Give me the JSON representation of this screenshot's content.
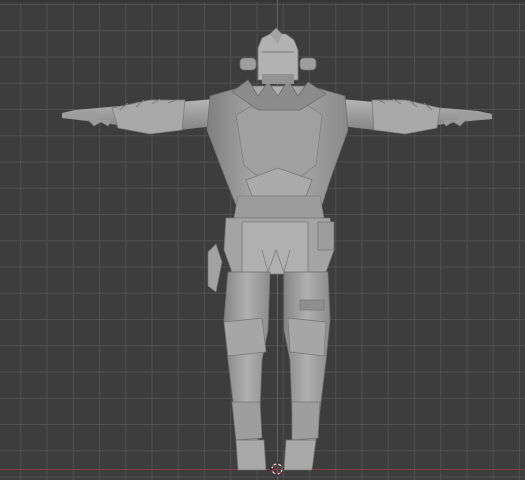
{
  "viewport": {
    "view_mode": "solid-shading",
    "subject": "character-model-t-pose",
    "colors": {
      "background": "#3d3d3d",
      "grid": "#505050",
      "z_axis": "#4c6fa8",
      "x_axis": "#8a3f49",
      "model_base": "#a3a3a3"
    }
  }
}
